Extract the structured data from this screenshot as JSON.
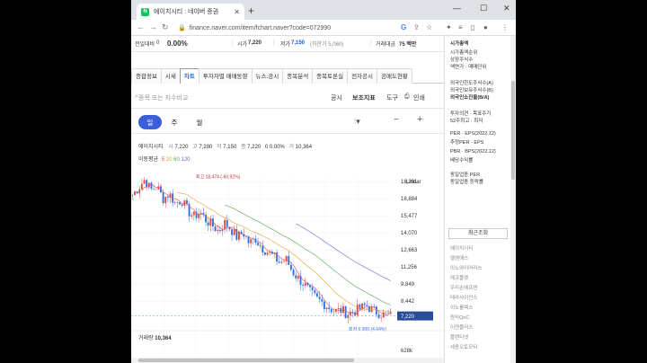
{
  "browser": {
    "tab_title": "에이치시티 : 네이버 증권",
    "favicon": "N",
    "url": "finance.naver.com/item/fchart.naver?code=072990"
  },
  "topinfo": {
    "label1": "전일대비",
    "value1": "0",
    "pct": "0.00%",
    "open_label": "시가",
    "open_value": "7,220",
    "low_label": "저가",
    "low_value": "7,150",
    "limit_label": "(하한가 5,060)",
    "amount_label": "거래대금",
    "amount_value": "75 백만"
  },
  "tabs": [
    "종합정보",
    "시세",
    "차트",
    "투자자별 매매동향",
    "뉴스.공시",
    "종목분석",
    "종목토론실",
    "전자공시",
    "공매도현황"
  ],
  "active_tab": "차트",
  "search": {
    "placeholder": "종목 또는 지수비교",
    "tool1": "공시",
    "tool2": "보조지표",
    "tool3": "도구",
    "print": "인쇄"
  },
  "period": {
    "day": "일",
    "week": "주",
    "month": "월"
  },
  "stock": {
    "name": "에이치시티",
    "open_l": "시",
    "open": "7,220",
    "high_l": "고",
    "high": "7,280",
    "low_l": "저",
    "low": "7,150",
    "close_l": "종",
    "close": "7,220",
    "change": "0",
    "change_pct": "0.00%",
    "vol_l": "거",
    "volume": "10,364"
  },
  "ma": {
    "label": "이동평균",
    "p5": "5",
    "p20": "20",
    "p60": "60",
    "p120": "120"
  },
  "axis": {
    "scale": "Linear",
    "ticks": [
      "18,291",
      "16,884",
      "15,477",
      "14,070",
      "12,663",
      "11,256",
      "9,849",
      "8,442"
    ],
    "vol_tick": "628k"
  },
  "annotations": {
    "high": "최고 18,474 (-60.92%)",
    "low": "최저 6,900 (4.64%)",
    "current": "7,220"
  },
  "volume_label": {
    "l": "거래량",
    "v": "10,364"
  },
  "sidebar": {
    "items": [
      "시가총액",
      "시가총액순위",
      "상장주식수",
      "액면가 · 매매단위",
      "외국인한도주식수(A)",
      "외국인보유주식수(B)",
      "외국인소진율(B/A)",
      "투자의견 · 목표주가",
      "52주최고 · 최저",
      "PER · EPS(2022.12)",
      "추정PER · EPS",
      "PBR · BPS(2022.12)",
      "배당수익률",
      "동일업종 PER",
      "동일업종 등락률"
    ],
    "recent_title": "최근조회",
    "recent": [
      "에이치시티",
      "엘엠에스",
      "이노와이어리스",
      "에코플랫",
      "우리손에프앤",
      "테라사이언스",
      "이노룰렉스",
      "원익QnC",
      "이엔플러스",
      "플랜티넷",
      "세종오토모티"
    ]
  },
  "chart_data": {
    "type": "candlestick",
    "y_range": [
      6600,
      18900
    ],
    "high": 18474,
    "low": 6900,
    "last": 7220,
    "ma_colors": {
      "ma5": "#e05050",
      "ma20": "#e0a030",
      "ma60": "#50a050",
      "ma120": "#7060d0"
    },
    "trend": [
      17200,
      17800,
      18474,
      17600,
      17900,
      16900,
      17300,
      16500,
      16800,
      15900,
      15400,
      15800,
      15100,
      14700,
      14200,
      14900,
      14400,
      13700,
      14100,
      13200,
      13600,
      12900,
      12500,
      12100,
      11600,
      11900,
      10900,
      10300,
      9800,
      9100,
      8600,
      8300,
      7900,
      7600,
      7700,
      7400,
      7600,
      7800,
      8100,
      7700,
      7500,
      7300,
      7220
    ]
  }
}
